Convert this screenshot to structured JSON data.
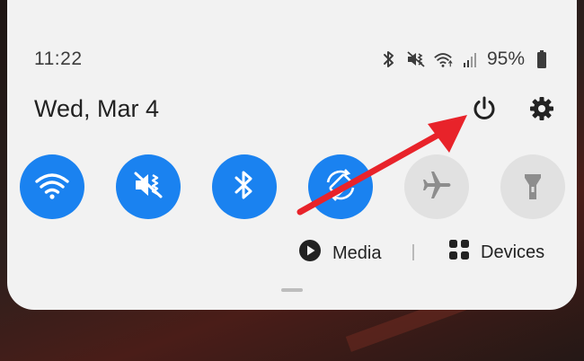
{
  "status_bar": {
    "time": "11:22",
    "battery_percent": "95%",
    "icons": [
      "bluetooth-icon",
      "vibrate-mute-icon",
      "wifi-icon",
      "signal-icon",
      "battery-icon"
    ]
  },
  "header": {
    "date": "Wed, Mar 4",
    "power_icon": "power-icon",
    "settings_icon": "gear-icon"
  },
  "quick_tiles": [
    {
      "name": "wifi",
      "icon": "wifi-icon",
      "state": "on"
    },
    {
      "name": "sound",
      "icon": "vibrate-mute-icon",
      "state": "on"
    },
    {
      "name": "bluetooth",
      "icon": "bluetooth-icon",
      "state": "on"
    },
    {
      "name": "auto-rotate",
      "icon": "rotate-icon",
      "state": "on"
    },
    {
      "name": "airplane-mode",
      "icon": "airplane-icon",
      "state": "off"
    },
    {
      "name": "flashlight",
      "icon": "flashlight-icon",
      "state": "off"
    }
  ],
  "bottom_row": {
    "media_label": "Media",
    "devices_label": "Devices"
  },
  "colors": {
    "tile_on": "#1a82f0",
    "tile_off": "#e1e1e1",
    "panel_bg": "#f2f2f2",
    "arrow": "#e8232a"
  }
}
